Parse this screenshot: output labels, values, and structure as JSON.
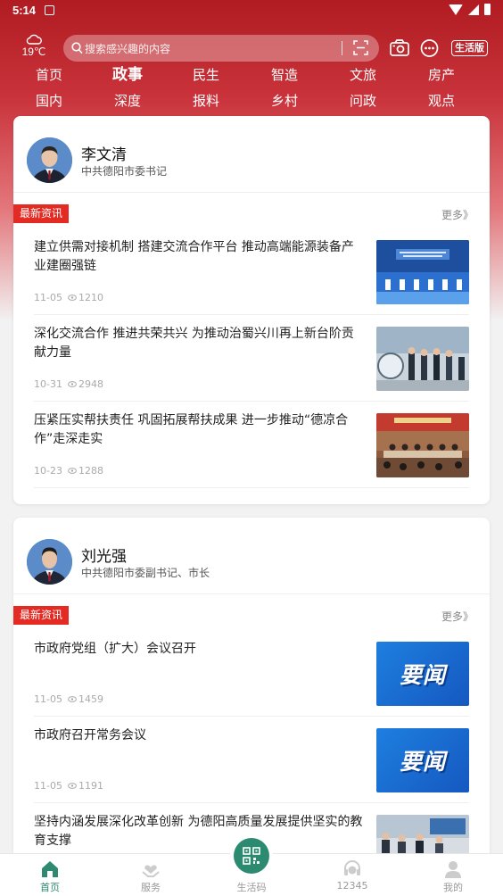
{
  "status_bar": {
    "time": "5:14"
  },
  "header": {
    "temperature": "19℃",
    "search_placeholder": "搜索感兴趣的内容",
    "badge_label": "生活版"
  },
  "categories": {
    "row1": [
      "首页",
      "政事",
      "民生",
      "智造",
      "文旅",
      "房产"
    ],
    "row2": [
      "国内",
      "深度",
      "报料",
      "乡村",
      "问政",
      "观点"
    ],
    "active": "政事"
  },
  "leaders": [
    {
      "name": "李文清",
      "title": "中共德阳市委书记",
      "section_label": "最新资讯",
      "more_label": "更多》",
      "news": [
        {
          "title": "建立供需对接机制 搭建交流合作平台 推动高端能源装备产业建圈强链",
          "date": "11-05",
          "views": "1210",
          "thumb": "conference-stage"
        },
        {
          "title": "深化交流合作 推进共荣共兴 为推动治蜀兴川再上新台阶贡献力量",
          "date": "10-31",
          "views": "2948",
          "thumb": "visit-group"
        },
        {
          "title": "压紧压实帮扶责任 巩固拓展帮扶成果 进一步推动“德凉合作”走深走实",
          "date": "10-23",
          "views": "1288",
          "thumb": "meeting-hall"
        }
      ]
    },
    {
      "name": "刘光强",
      "title": "中共德阳市委副书记、市长",
      "section_label": "最新资讯",
      "more_label": "更多》",
      "news": [
        {
          "title": "市政府党组（扩大）会议召开",
          "date": "11-05",
          "views": "1459",
          "thumb": "yaowen",
          "thumb_text": "要闻"
        },
        {
          "title": "市政府召开常务会议",
          "date": "11-05",
          "views": "1191",
          "thumb": "yaowen",
          "thumb_text": "要闻"
        },
        {
          "title": "坚持内涵发展深化改革创新 为德阳高质量发展提供坚实的教育支撑",
          "date": "",
          "views": "",
          "thumb": "classroom"
        }
      ]
    }
  ],
  "bottom_nav": [
    {
      "label": "首页",
      "icon": "home-icon",
      "active": true
    },
    {
      "label": "服务",
      "icon": "heart-hands-icon",
      "active": false
    },
    {
      "label": "生活码",
      "icon": "qr-code-icon",
      "active": false
    },
    {
      "label": "12345",
      "icon": "headset-icon",
      "active": false
    },
    {
      "label": "我的",
      "icon": "user-icon",
      "active": false
    }
  ],
  "colors": {
    "brand_red": "#b01c22",
    "tag_red": "#e32b24",
    "active_green": "#2b8a6f"
  }
}
